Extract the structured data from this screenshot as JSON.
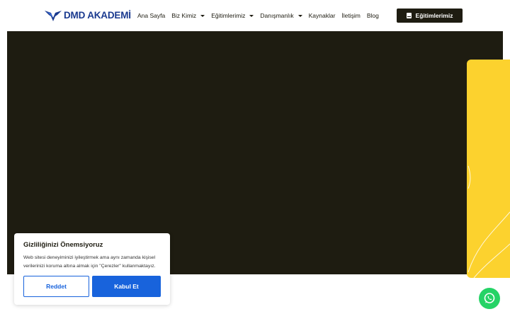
{
  "header": {
    "logo_text": "DMD AKADEMİ",
    "nav": [
      {
        "label": "Ana Sayfa",
        "dropdown": false
      },
      {
        "label": "Biz Kimiz",
        "dropdown": true
      },
      {
        "label": "Eğitimlerimiz",
        "dropdown": true
      },
      {
        "label": "Danışmanlık",
        "dropdown": true
      },
      {
        "label": "Kaynaklar",
        "dropdown": false
      },
      {
        "label": "İletişim",
        "dropdown": false
      },
      {
        "label": "Blog",
        "dropdown": false
      }
    ],
    "cta_label": "Eğitimlerimiz",
    "cta_icon": "book-icon"
  },
  "cookie": {
    "title": "Gizliliğinizi Önemsiyoruz",
    "text": "Web sitesi deneyiminizi iyileştirmek ama aynı zamanda kişisel verilerinizi koruma altına almak için \"Çerezler\" kullanmaktayız.",
    "reject_label": "Reddet",
    "accept_label": "Kabul Et"
  },
  "icons": {
    "logo": "eagle-logo-icon",
    "whatsapp": "whatsapp-icon",
    "dropdown": "chevron-down-icon"
  },
  "colors": {
    "dark": "#1e1c11",
    "accent_yellow": "#fcd22e",
    "brand_blue": "#1a3a8f",
    "button_blue": "#1863dc",
    "whatsapp_green": "#25d366"
  }
}
